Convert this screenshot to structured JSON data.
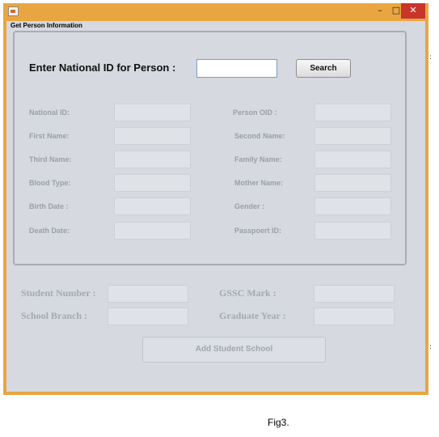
{
  "window": {
    "minimize": "–",
    "maximize": "□",
    "close": "✕",
    "app_icon": "java-app-icon"
  },
  "form_title": "Get Person Information",
  "search": {
    "prompt": "Enter National ID for Person :",
    "input_value": "",
    "button_label": "Search"
  },
  "person_fields": {
    "national_id": "National ID:",
    "person_oid": "Person OID :",
    "first_name": "First Name:",
    "second_name": "Second Name:",
    "third_name": "Third Name:",
    "family_name": "Family Name:",
    "blood_type": "Blood Type:",
    "mother_name": "Mother Name:",
    "birth_date": "Birth Date :",
    "gender": "Gender :",
    "death_date": "Death Date:",
    "passport_id": "Passpoert ID:"
  },
  "student_fields": {
    "student_number": "Student Number :",
    "gssc_mark": "GSSC Mark :",
    "school_branch": "School Branch :",
    "graduate_year": "Graduate Year :"
  },
  "add_button_label": "Add Student School",
  "caption": "Fig3."
}
